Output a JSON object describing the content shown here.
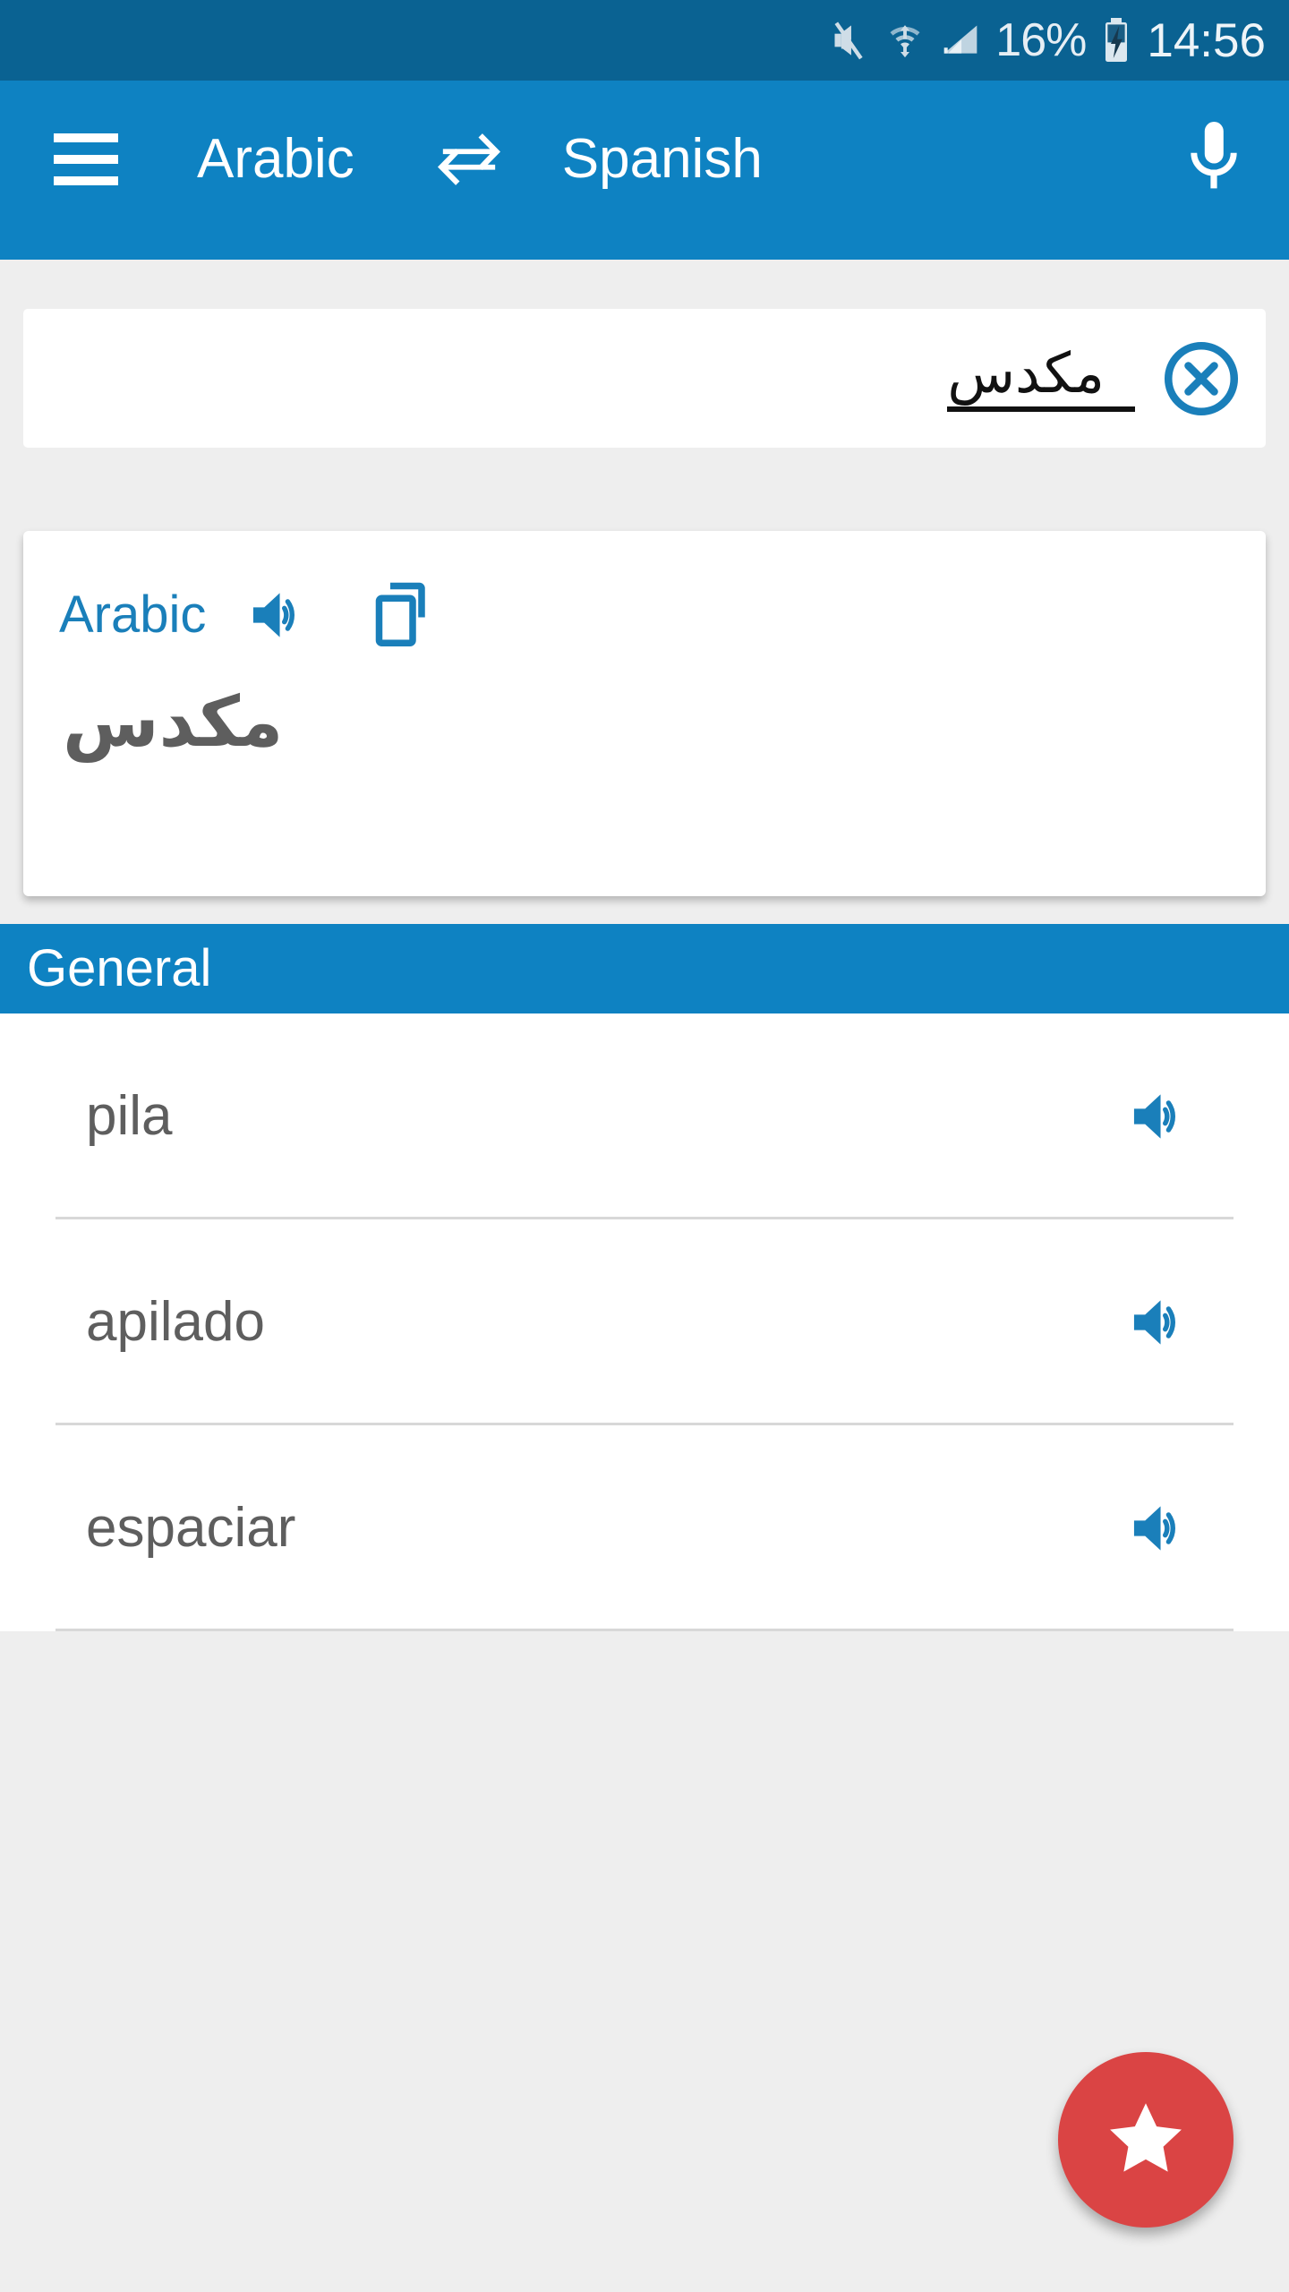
{
  "status_bar": {
    "battery_percent": "16%",
    "time": "14:56",
    "icons": [
      "mute-icon",
      "wifi-icon",
      "signal-icon",
      "battery-charging-icon"
    ],
    "background_color": "#0a6292"
  },
  "app_bar": {
    "menu_icon": "hamburger-menu-icon",
    "source_language": "Arabic",
    "swap_icon": "swap-arrows-icon",
    "target_language": "Spanish",
    "mic_icon": "microphone-icon",
    "background_color": "#0e82c2"
  },
  "search": {
    "value": "مكدس",
    "placeholder": "",
    "clear_icon": "clear-circle-x-icon"
  },
  "source_card": {
    "language_label": "Arabic",
    "speaker_icon": "speaker-icon",
    "copy_icon": "copy-icon",
    "word": "مكدس"
  },
  "section": {
    "title": "General"
  },
  "results": [
    {
      "word": "pila",
      "speaker_icon": "speaker-icon"
    },
    {
      "word": "apilado",
      "speaker_icon": "speaker-icon"
    },
    {
      "word": "espaciar",
      "speaker_icon": "speaker-icon"
    }
  ],
  "fab": {
    "icon": "star-icon",
    "color": "#da4444"
  },
  "colors": {
    "status_bar": "#0a6292",
    "primary": "#0e82c2",
    "accent_blue": "#1a7fba",
    "fab_red": "#da4444",
    "text_gray": "#5e5e5e",
    "page_bg": "#eeeeee"
  }
}
